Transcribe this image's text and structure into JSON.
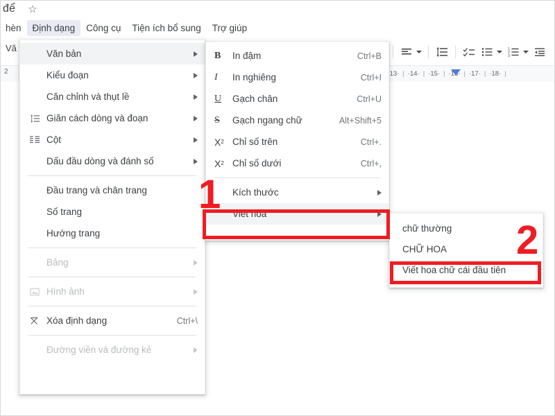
{
  "window": {
    "doc_title": "để",
    "star_icon": "star-icon"
  },
  "menubar": {
    "items": [
      {
        "label": "hèn",
        "active": false
      },
      {
        "label": "Định dạng",
        "active": true
      },
      {
        "label": "Công cụ",
        "active": false
      },
      {
        "label": "Tiện ích bổ sung",
        "active": false
      },
      {
        "label": "Trợ giúp",
        "active": false
      }
    ]
  },
  "document_fragment": {
    "text_behind": "Vă",
    "left_ruler_number": "2"
  },
  "toolbar": {
    "icons": [
      {
        "name": "caret-down-icon",
        "glyph": "▾"
      },
      {
        "name": "align-left-icon",
        "glyph": "≡"
      },
      {
        "name": "align-dropdown-caret-icon",
        "glyph": "▾"
      },
      {
        "name": "line-spacing-icon",
        "glyph": "⇕"
      },
      {
        "name": "checklist-icon",
        "glyph": "☑"
      },
      {
        "name": "bulleted-list-icon",
        "glyph": "☰"
      },
      {
        "name": "bulleted-list-caret-icon",
        "glyph": "▾"
      },
      {
        "name": "numbered-list-icon",
        "glyph": "≡"
      },
      {
        "name": "numbered-list-caret-icon",
        "glyph": "▾"
      },
      {
        "name": "decrease-indent-icon",
        "glyph": "⇤"
      }
    ]
  },
  "ruler": {
    "numbers": [
      "13",
      "14",
      "15",
      "16",
      "17",
      "18"
    ],
    "indent_marker_color": "#4a7fd4"
  },
  "menus": {
    "format": {
      "name": "format-menu",
      "items": [
        {
          "label": "Văn bản",
          "icon": "",
          "accel": "",
          "submenu": true,
          "highlighted": true,
          "disabled": false
        },
        {
          "label": "Kiểu đoạn",
          "icon": "",
          "accel": "",
          "submenu": true,
          "highlighted": false,
          "disabled": false
        },
        {
          "label": "Căn chỉnh và thụt lề",
          "icon": "",
          "accel": "",
          "submenu": true,
          "highlighted": false,
          "disabled": false
        },
        {
          "label": "Giãn cách dòng và đoạn",
          "icon": "line-spacing-icon",
          "accel": "",
          "submenu": true,
          "highlighted": false,
          "disabled": false
        },
        {
          "label": "Cột",
          "icon": "columns-icon",
          "accel": "",
          "submenu": true,
          "highlighted": false,
          "disabled": false
        },
        {
          "label": "Dấu đầu dòng và đánh số",
          "icon": "",
          "accel": "",
          "submenu": true,
          "highlighted": false,
          "disabled": false
        },
        {
          "separator": true
        },
        {
          "label": "Đầu trang và chân trang",
          "icon": "",
          "accel": "",
          "submenu": false,
          "highlighted": false,
          "disabled": false
        },
        {
          "label": "Số trang",
          "icon": "",
          "accel": "",
          "submenu": false,
          "highlighted": false,
          "disabled": false
        },
        {
          "label": "Hướng trang",
          "icon": "",
          "accel": "",
          "submenu": false,
          "highlighted": false,
          "disabled": false
        },
        {
          "separator": true
        },
        {
          "label": "Bảng",
          "icon": "",
          "accel": "",
          "submenu": true,
          "highlighted": false,
          "disabled": true
        },
        {
          "separator": true
        },
        {
          "label": "Hình ảnh",
          "icon": "image-icon",
          "accel": "",
          "submenu": true,
          "highlighted": false,
          "disabled": true
        },
        {
          "separator": true
        },
        {
          "label": "Xóa định dạng",
          "icon": "clear-formatting-icon",
          "accel": "Ctrl+\\",
          "submenu": false,
          "highlighted": false,
          "disabled": false
        },
        {
          "separator": true
        },
        {
          "label": "Đường viền và đường kẻ",
          "icon": "",
          "accel": "",
          "submenu": true,
          "highlighted": false,
          "disabled": true
        }
      ]
    },
    "text": {
      "name": "text-submenu",
      "items": [
        {
          "label": "In đậm",
          "glyph": "B",
          "glyph_class": "gl-b",
          "icon": "bold-icon",
          "accel": "Ctrl+B",
          "submenu": false,
          "highlighted": false
        },
        {
          "label": "In nghiêng",
          "glyph": "I",
          "glyph_class": "gl-i",
          "icon": "italic-icon",
          "accel": "Ctrl+I",
          "submenu": false,
          "highlighted": false
        },
        {
          "label": "Gạch chân",
          "glyph": "U",
          "glyph_class": "gl-u",
          "icon": "underline-icon",
          "accel": "Ctrl+U",
          "submenu": false,
          "highlighted": false
        },
        {
          "label": "Gạch ngang chữ",
          "glyph": "S",
          "glyph_class": "gl-s",
          "icon": "strikethrough-icon",
          "accel": "Alt+Shift+5",
          "submenu": false,
          "highlighted": false
        },
        {
          "label": "Chỉ số trên",
          "glyph": "X²",
          "glyph_class": "gl-sup",
          "icon": "superscript-icon",
          "accel": "Ctrl+.",
          "submenu": false,
          "highlighted": false
        },
        {
          "label": "Chỉ số dưới",
          "glyph": "X₂",
          "glyph_class": "gl-sub",
          "icon": "subscript-icon",
          "accel": "Ctrl+,",
          "submenu": false,
          "highlighted": false
        },
        {
          "separator": true
        },
        {
          "label": "Kích thước",
          "glyph": "",
          "glyph_class": "",
          "icon": "",
          "accel": "",
          "submenu": true,
          "highlighted": false
        },
        {
          "label": "Viết hoa",
          "glyph": "",
          "glyph_class": "",
          "icon": "",
          "accel": "",
          "submenu": true,
          "highlighted": true
        }
      ]
    },
    "capitalization": {
      "name": "capitalization-submenu",
      "items": [
        {
          "label": "chữ thường",
          "highlighted": false
        },
        {
          "label": "CHỮ HOA",
          "highlighted": false
        },
        {
          "label": "Viết hoa chữ cái đầu tiên",
          "highlighted": false
        }
      ]
    }
  },
  "annotations": {
    "color": "#ee1d23",
    "step_one": "1",
    "step_two": "2",
    "highlight_one_target": "Viết hoa",
    "highlight_two_target": "Viết hoa chữ cái đầu tiên"
  }
}
